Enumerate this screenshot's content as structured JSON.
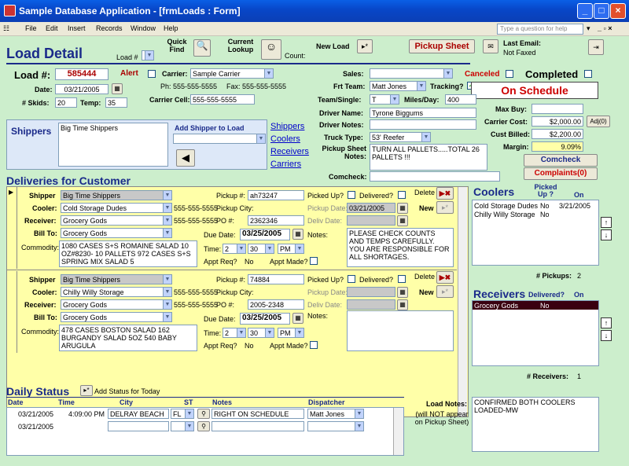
{
  "window": {
    "title": "Sample Database Application - [frmLoads : Form]"
  },
  "menu": {
    "items": [
      "File",
      "Edit",
      "Insert",
      "Records",
      "Window",
      "Help"
    ],
    "help_placeholder": "Type a question for help"
  },
  "header": {
    "title": "Load Detail",
    "load_no_label": "Load #",
    "quick_find": "Quick Find",
    "current_lookup": "Current Lookup",
    "count_label": "Count:",
    "new_load": "New Load",
    "pickup_sheet": "Pickup Sheet",
    "last_email_label": "Last Email:",
    "last_email_value": "Not Faxed"
  },
  "load": {
    "label": "Load #:",
    "value": "585444",
    "alert_label": "Alert",
    "date_label": "Date:",
    "date": "03/21/2005",
    "skids_label": "# Skids:",
    "skids": "20",
    "temp_label": "Temp:",
    "temp": "35"
  },
  "carrier": {
    "label": "Carrier:",
    "value": "Sample Carrier",
    "phone": "Ph: 555-555-5555",
    "fax": "Fax: 555-555-5555",
    "cell_label": "Carrier Cell:",
    "cell": "555-555-5555"
  },
  "right": {
    "sales_label": "Sales:",
    "sales": "",
    "canceled_label": "Canceled",
    "completed_label": "Completed",
    "frt_team_label": "Frt Team:",
    "frt_team": "Matt Jones",
    "tracking_label": "Tracking?",
    "status": "On Schedule",
    "team_single_label": "Team/Single:",
    "team_single": "T",
    "miles_label": "Miles/Day:",
    "miles": "400",
    "driver_name_label": "Driver Name:",
    "driver_name": "Tyrone Biggums",
    "driver_notes_label": "Driver Notes:",
    "truck_type_label": "Truck Type:",
    "truck_type": "53' Reefer",
    "pickup_notes_label": "Pickup Sheet Notes:",
    "pickup_notes": "TURN ALL PALLETS.....TOTAL 26 PALLETS !!!",
    "comcheck_label": "Comcheck:"
  },
  "money": {
    "max_buy_label": "Max Buy:",
    "max_buy": "",
    "carrier_cost_label": "Carrier Cost:",
    "carrier_cost": "$2,000.00",
    "adj": "Adj(0)",
    "cust_billed_label": "Cust Billed:",
    "cust_billed": "$2,200.00",
    "margin_label": "Margin:",
    "margin": "9.09%",
    "comcheck_btn": "Comcheck",
    "complaints_btn": "Complaints(0)"
  },
  "shippers": {
    "title": "Shippers",
    "list": "Big Time Shippers",
    "add_label": "Add Shipper to Load",
    "links": [
      "Shippers",
      "Coolers",
      "Receivers",
      "Carriers"
    ]
  },
  "deliveries": {
    "title": "Deliveries for Customer",
    "labels": {
      "shipper": "Shipper",
      "cooler": "Cooler:",
      "receiver": "Receiver:",
      "bill_to": "Bill To:",
      "commodity": "Commodity:",
      "pickup_no": "Pickup #:",
      "pickup_city": "Pickup City:",
      "po_no": "PO #:",
      "due_date": "Due Date:",
      "time": "Time:",
      "appt_req": "Appt Req?",
      "appt_made": "Appt Made?",
      "picked_up": "Picked Up?",
      "delivered": "Delivered?",
      "delete": "Delete",
      "new": "New",
      "pickup_date": "Pickup Date:",
      "deliv_date": "Deliv Date:",
      "notes": "Notes:"
    },
    "rows": [
      {
        "shipper": "Big Time Shippers",
        "cooler": "Cold Storage Dudes",
        "cooler_phone": "555-555-5555",
        "receiver": "Grocery Gods",
        "receiver_phone": "555-555-5555",
        "bill_to": "Grocery Gods",
        "commodity": "1080 CASES S+S ROMAINE SALAD 10 OZ#8230- 10 PALLETS 972 CASES S+S SPRING MIX SALAD 5",
        "pickup_no": "ah73247",
        "po_no": "2362346",
        "due_date": "03/25/2005",
        "time_h": "2",
        "time_m": "30",
        "time_ap": "PM",
        "appt_req": "No",
        "pickup_date": "03/21/2005",
        "notes": "PLEASE CHECK COUNTS AND TEMPS CAREFULLY. YOU ARE RESPONSIBLE FOR ALL SHORTAGES."
      },
      {
        "shipper": "Big Time Shippers",
        "cooler": "Chilly Willy Storage",
        "cooler_phone": "555-555-5555",
        "receiver": "Grocery Gods",
        "receiver_phone": "555-555-5555",
        "bill_to": "Grocery Gods",
        "commodity": "478 CASES BOSTON SALAD 162 BURGANDY SALAD 5OZ 540 BABY ARUGULA",
        "pickup_no": "74884",
        "po_no": "2005-2348",
        "due_date": "03/25/2005",
        "time_h": "2",
        "time_m": "30",
        "time_ap": "PM",
        "appt_req": "No",
        "pickup_date": "",
        "notes": ""
      }
    ]
  },
  "coolers": {
    "title": "Coolers",
    "col_picked": "Picked Up ?",
    "col_on": "On",
    "rows": [
      {
        "name": "Cold Storage Dudes",
        "picked": "No",
        "on": "3/21/2005"
      },
      {
        "name": "Chilly Willy Storage",
        "picked": "No",
        "on": ""
      }
    ],
    "count_label": "# Pickups:",
    "count": "2"
  },
  "receivers": {
    "title": "Receivers",
    "col_delivered": "Delivered?",
    "col_on": "On",
    "rows": [
      {
        "name": "Grocery Gods",
        "delivered": "No",
        "on": ""
      }
    ],
    "count_label": "# Receivers:",
    "count": "1"
  },
  "daily": {
    "title": "Daily Status",
    "add_label": "Add Status for Today",
    "cols": [
      "Date",
      "Time",
      "City",
      "ST",
      "Notes",
      "Dispatcher"
    ],
    "rows": [
      {
        "date": "03/21/2005",
        "time": "4:09:00 PM",
        "city": "DELRAY BEACH",
        "st": "FL",
        "notes": "RIGHT ON SCHEDULE",
        "dispatcher": "Matt Jones"
      },
      {
        "date": "03/21/2005",
        "time": "",
        "city": "",
        "st": "",
        "notes": "",
        "dispatcher": ""
      }
    ]
  },
  "load_notes": {
    "label": "Load Notes:",
    "sub": "(will NOT appear on Pickup Sheet)",
    "value": "CONFIRMED BOTH COOLERS LOADED-MW"
  }
}
